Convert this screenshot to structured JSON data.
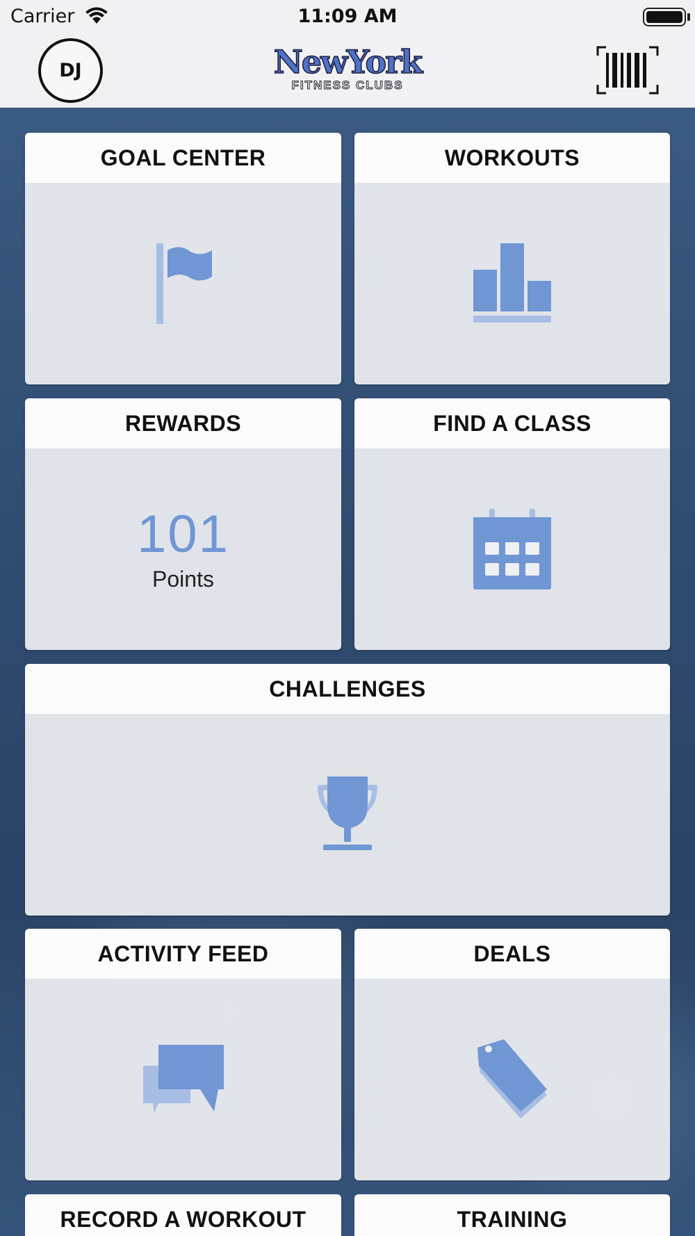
{
  "status_bar": {
    "carrier": "Carrier",
    "time": "11:09 AM"
  },
  "header": {
    "avatar_initials": "DJ",
    "logo_main": "NewYork",
    "logo_sub": "FITNESS CLUBS"
  },
  "tiles": {
    "goal_center": {
      "title": "GOAL CENTER",
      "icon": "flag-icon"
    },
    "workouts": {
      "title": "WORKOUTS",
      "icon": "bar-chart-icon"
    },
    "rewards": {
      "title": "REWARDS",
      "points": "101",
      "points_label": "Points"
    },
    "find_a_class": {
      "title": "FIND A CLASS",
      "icon": "calendar-icon"
    },
    "challenges": {
      "title": "CHALLENGES",
      "icon": "trophy-icon"
    },
    "activity_feed": {
      "title": "ACTIVITY FEED",
      "icon": "chat-bubbles-icon"
    },
    "deals": {
      "title": "DEALS",
      "icon": "tag-icon"
    },
    "record_a_workout": {
      "title": "RECORD A WORKOUT"
    },
    "training": {
      "title": "TRAINING"
    }
  },
  "colors": {
    "accent_icon": "#7096d4",
    "accent_icon_light": "#a7bde3",
    "header_bg": "#f1f1f3"
  }
}
